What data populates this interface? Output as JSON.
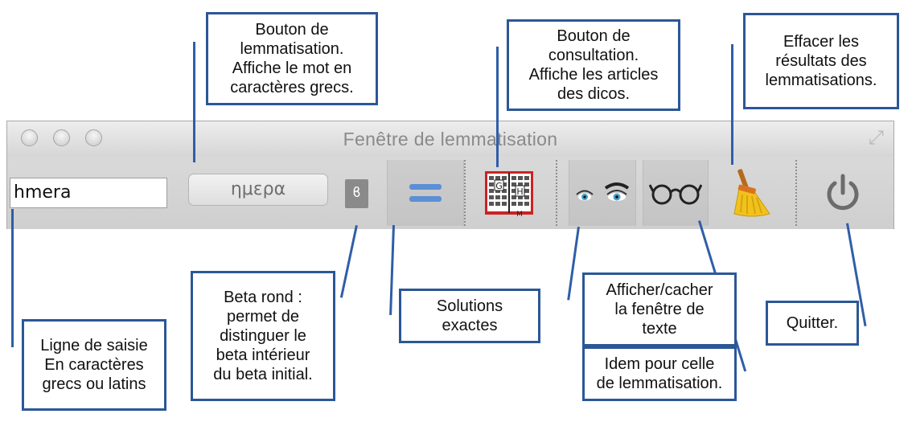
{
  "window": {
    "title": "Fenêtre de lemmatisation",
    "input_value": "hmera",
    "greek_button_label": "ημερα",
    "beta_button_label": "ϐ"
  },
  "annotations": {
    "lemmatize_button": "Bouton de\nlemmatisation.\nAffiche le mot en\ncaractères grecs.",
    "consult_button": "Bouton de\nconsultation.\nAffiche les articles\ndes dicos.",
    "clear_results": "Effacer les\nrésultats des\nlemmatisations.",
    "beta_round": "Beta rond :\npermet de\ndistinguer le\nbeta intérieur\ndu beta initial.",
    "exact_solutions": "Solutions\nexactes",
    "toggle_text_window": "Afficher/cacher\nla fenêtre de\ntexte",
    "idem_lemmatisation": "Idem pour celle\nde lemmatisation.",
    "quit": "Quitter.",
    "input_line": "Ligne de saisie\nEn caractères\ngrecs ou latins"
  },
  "colors": {
    "annotation_border": "#2b5797",
    "equals_icon": "#5b8fd6",
    "broom_yellow": "#f2c21b",
    "power_gray": "#6c6c6c"
  },
  "icons": [
    "equals-icon",
    "dictionary-book-icon",
    "eyes-icon",
    "glasses-icon",
    "broom-icon",
    "power-icon"
  ]
}
